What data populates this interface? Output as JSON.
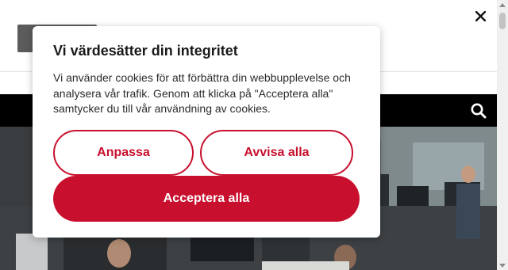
{
  "cookie_dialog": {
    "title": "Vi värdesätter din integritet",
    "body": "Vi använder cookies för att förbättra din webbupplevelse och analysera vår trafik. Genom att klicka på \"Acceptera alla\" samtycker du till vår användning av cookies.",
    "customize_label": "Anpassa",
    "reject_label": "Avvisa alla",
    "accept_label": "Acceptera alla",
    "accent_color": "#c8102e"
  },
  "header": {
    "close_icon": "close-icon",
    "search_icon": "search-icon",
    "nav_bar_color": "#000000"
  },
  "hero": {
    "image": "open-plan-office-photo"
  }
}
